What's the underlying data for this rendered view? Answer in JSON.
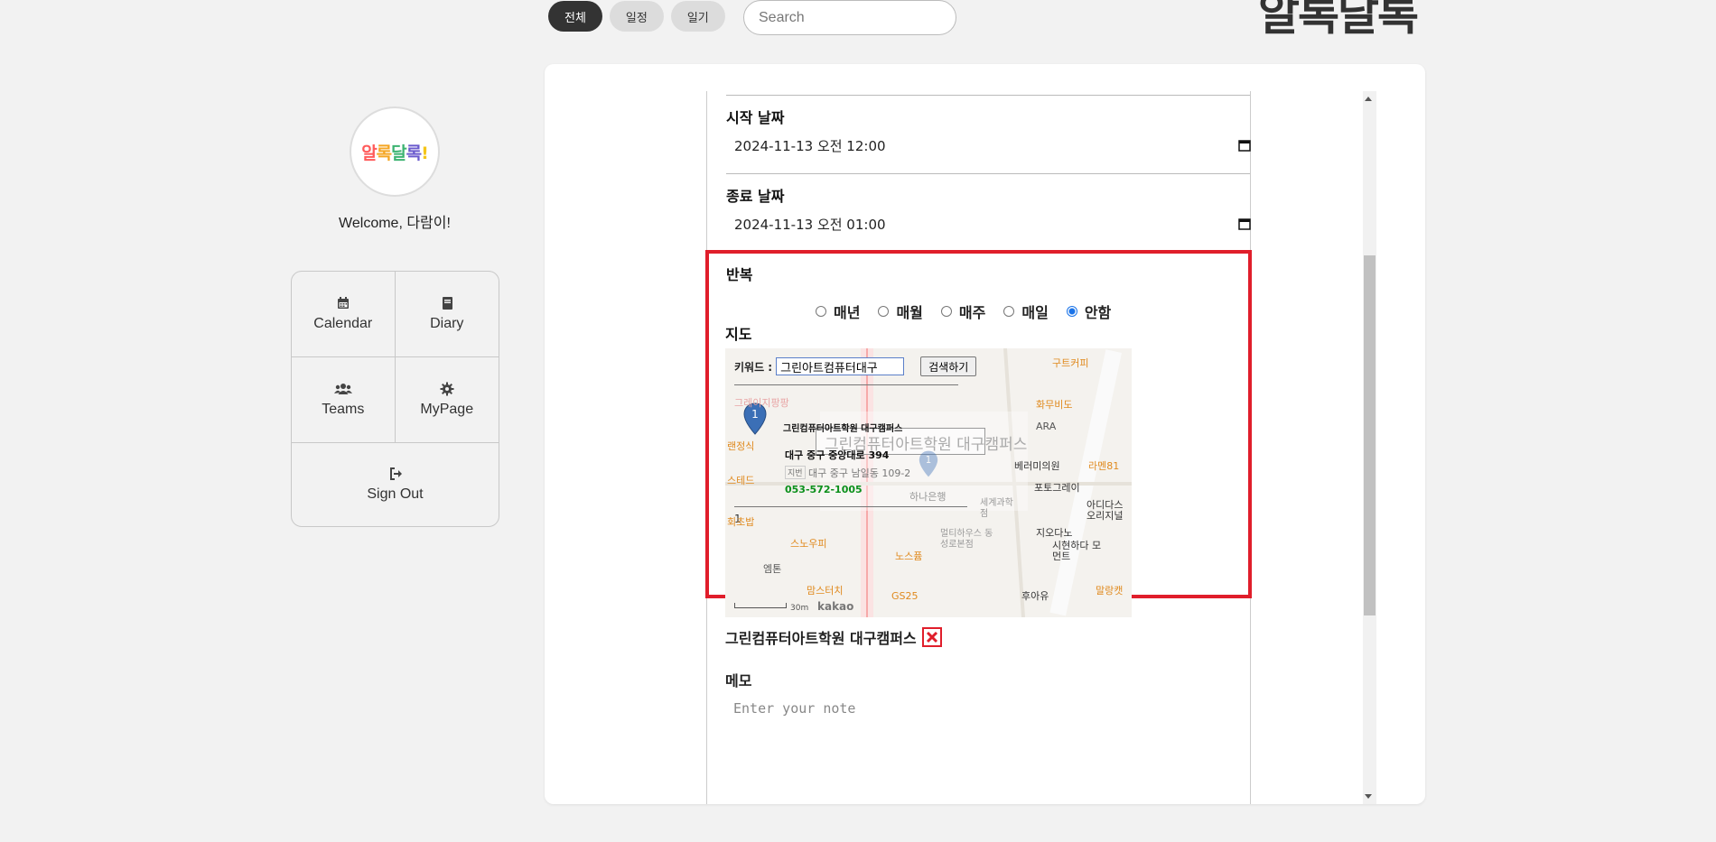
{
  "filters": [
    {
      "label": "전체",
      "active": true
    },
    {
      "label": "일정",
      "active": false
    },
    {
      "label": "일기",
      "active": false
    }
  ],
  "search": {
    "placeholder": "Search"
  },
  "brand": {
    "title": "알록달록"
  },
  "sidebar": {
    "avatar_text": "알록달록",
    "welcome": "Welcome, 다람이!",
    "nav": [
      {
        "label": "Calendar",
        "icon": "calendar-icon"
      },
      {
        "label": "Diary",
        "icon": "book-icon"
      },
      {
        "label": "Teams",
        "icon": "users-icon"
      },
      {
        "label": "MyPage",
        "icon": "gear-icon"
      },
      {
        "label": "Sign Out",
        "icon": "sign-out-icon"
      }
    ]
  },
  "form": {
    "start": {
      "label": "시작 날짜",
      "value": "2024-11-13  오전  12:00"
    },
    "end": {
      "label": "종료 날짜",
      "value": "2024-11-13  오전  01:00"
    },
    "repeat": {
      "label": "반복",
      "options": [
        {
          "label": "매년",
          "checked": false
        },
        {
          "label": "매월",
          "checked": false
        },
        {
          "label": "매주",
          "checked": false
        },
        {
          "label": "매일",
          "checked": false
        },
        {
          "label": "안함",
          "checked": true
        }
      ]
    },
    "map": {
      "label": "지도",
      "keyword_label": "키워드 :",
      "keyword_value": "그린아트컴퓨터대구",
      "search_button": "검색하기",
      "info_title": "그린컴퓨터아트학원 대구캠퍼스",
      "info_address": "대구 중구 중앙대로 394",
      "info_jibun_tag": "지번",
      "info_jibun": "대구 중구 남일동 109-2",
      "info_phone": "053-572-1005",
      "overlay_title": "그린컴퓨터아트학원 대구캠퍼스",
      "marker_number": "1",
      "pager": "1",
      "scale": "30m",
      "provider": "kakao",
      "labels": [
        "구트커피",
        "화무비도",
        "ARA",
        "베러미의원",
        "라멘81",
        "포토그레이",
        "아디다스 오리지널",
        "지오다노",
        "시현하다 모먼트",
        "말랑캣",
        "후아유",
        "하나은행",
        "세계과학점",
        "멀티하우스 동성로본점",
        "노스퓸",
        "GS25",
        "맘스터치",
        "스노우피",
        "엠톤",
        "회초밥",
        "스테드",
        "그레이지팡팡",
        "랜정식"
      ]
    },
    "selected_place": "그린컴퓨터아트학원 대구캠퍼스",
    "memo": {
      "label": "메모",
      "placeholder": "Enter your note"
    }
  },
  "colors": {
    "highlight": "#e01e2b",
    "radio_checked": "#1a73e8",
    "phone": "#0a8f1a"
  }
}
